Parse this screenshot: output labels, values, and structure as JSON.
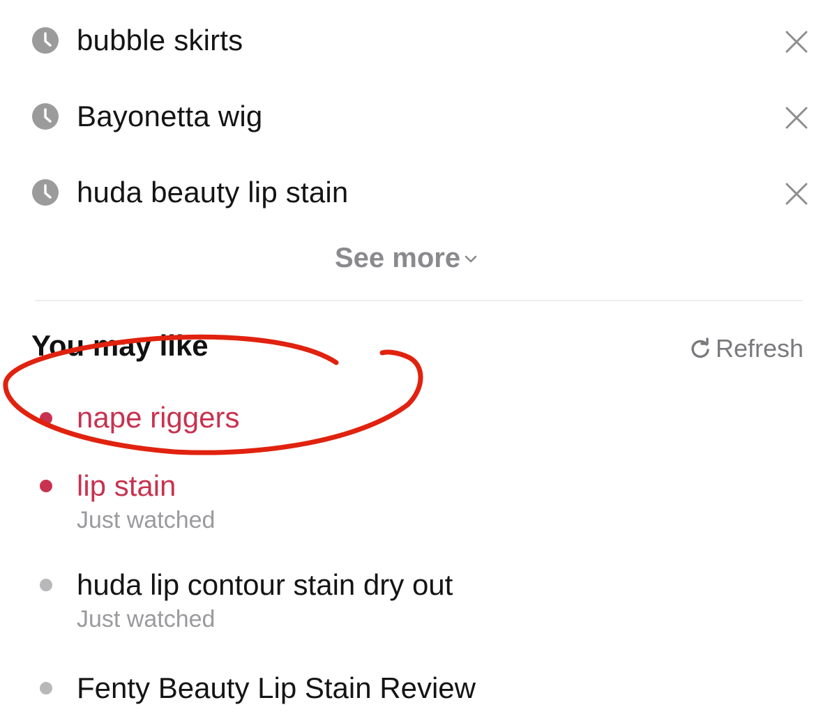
{
  "history": [
    {
      "label": "bubble skirts"
    },
    {
      "label": "Bayonetta wig"
    },
    {
      "label": "huda beauty lip stain"
    }
  ],
  "see_more": {
    "label": "See more"
  },
  "you_may_like": {
    "title": "You may like",
    "refresh_label": "Refresh",
    "items": [
      {
        "label": "nape riggers",
        "sub": "",
        "highlighted": true
      },
      {
        "label": "lip stain",
        "sub": "Just watched",
        "highlighted": true
      },
      {
        "label": "huda lip contour stain dry out",
        "sub": "Just watched",
        "highlighted": false
      },
      {
        "label": "Fenty Beauty Lip Stain Review",
        "sub": "",
        "highlighted": false
      }
    ]
  },
  "colors": {
    "highlight": "#c8324f",
    "text": "#141414",
    "muted": "#9a9a9e",
    "icon_gray": "#9b9b9b",
    "annotation_red": "#e0220f"
  },
  "icons": {
    "history": "clock-icon",
    "remove": "close-icon",
    "see_more": "chevron-down-icon",
    "refresh": "refresh-icon"
  }
}
